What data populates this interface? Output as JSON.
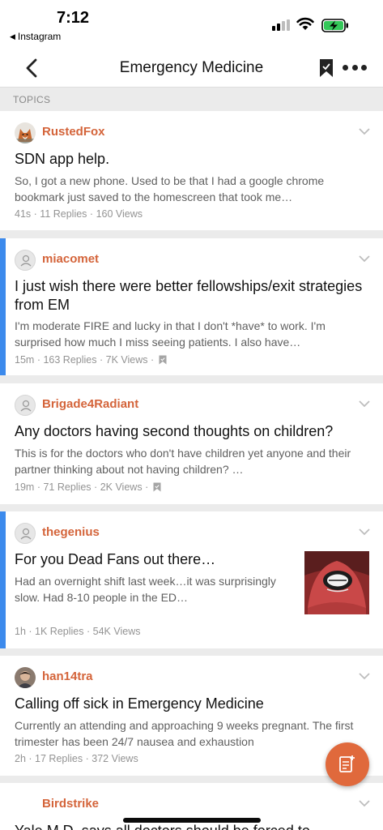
{
  "status_bar": {
    "time": "7:12",
    "back_app": "Instagram",
    "back_icon": "triangle-left-icon",
    "signal_icon": "cellular-signal-icon",
    "wifi_icon": "wifi-icon",
    "battery_icon": "battery-charging-icon"
  },
  "nav": {
    "title": "Emergency Medicine",
    "back_icon": "chevron-left-icon",
    "bookmark_icon": "bookmark-icon",
    "more_icon": "more-horizontal-icon"
  },
  "section": {
    "label": "TOPICS"
  },
  "colors": {
    "accent_orange": "#d4643a",
    "unread_blue": "#3c8aec",
    "fab_orange": "#e0693c"
  },
  "topics": [
    {
      "author": "RustedFox",
      "title": "SDN app help.",
      "excerpt": "So, I got a new phone. Used to be that I had a google chrome bookmark just saved to the homescreen that took me…",
      "age": "41s",
      "replies": "11 Replies",
      "views": "160 Views"
    },
    {
      "author": "miacomet",
      "title": "I just wish there were better fellowships/exit strategies from EM",
      "excerpt": "I'm moderate FIRE and lucky in that I don't *have* to work. I'm surprised how much I miss seeing patients. I also have…",
      "age": "15m",
      "replies": "163 Replies",
      "views": "7K Views"
    },
    {
      "author": "Brigade4Radiant",
      "title": "Any doctors having second thoughts on children?",
      "excerpt": "This is for the doctors who don't have children yet anyone and their partner thinking about not having children? …",
      "age": "19m",
      "replies": "71 Replies",
      "views": "2K Views"
    },
    {
      "author": "thegenius",
      "title": "For you Dead Fans out there…",
      "excerpt": "Had an overnight shift last week…it was surprisingly slow.  Had 8-10 people in the ED…",
      "age": "1h",
      "replies": "1K Replies",
      "views": "54K Views"
    },
    {
      "author": "han14tra",
      "title": "Calling off sick in Emergency Medicine",
      "excerpt": "Currently an attending and approaching 9 weeks pregnant. The first trimester has been 24/7 nausea and exhaustion",
      "age": "2h",
      "replies": "17 Replies",
      "views": "372 Views"
    },
    {
      "author": "Birdstrike",
      "title": "Yale M.D. says all doctors should be forced to"
    }
  ],
  "meta_separator": "·",
  "fab": {
    "icon": "new-topic-icon"
  }
}
